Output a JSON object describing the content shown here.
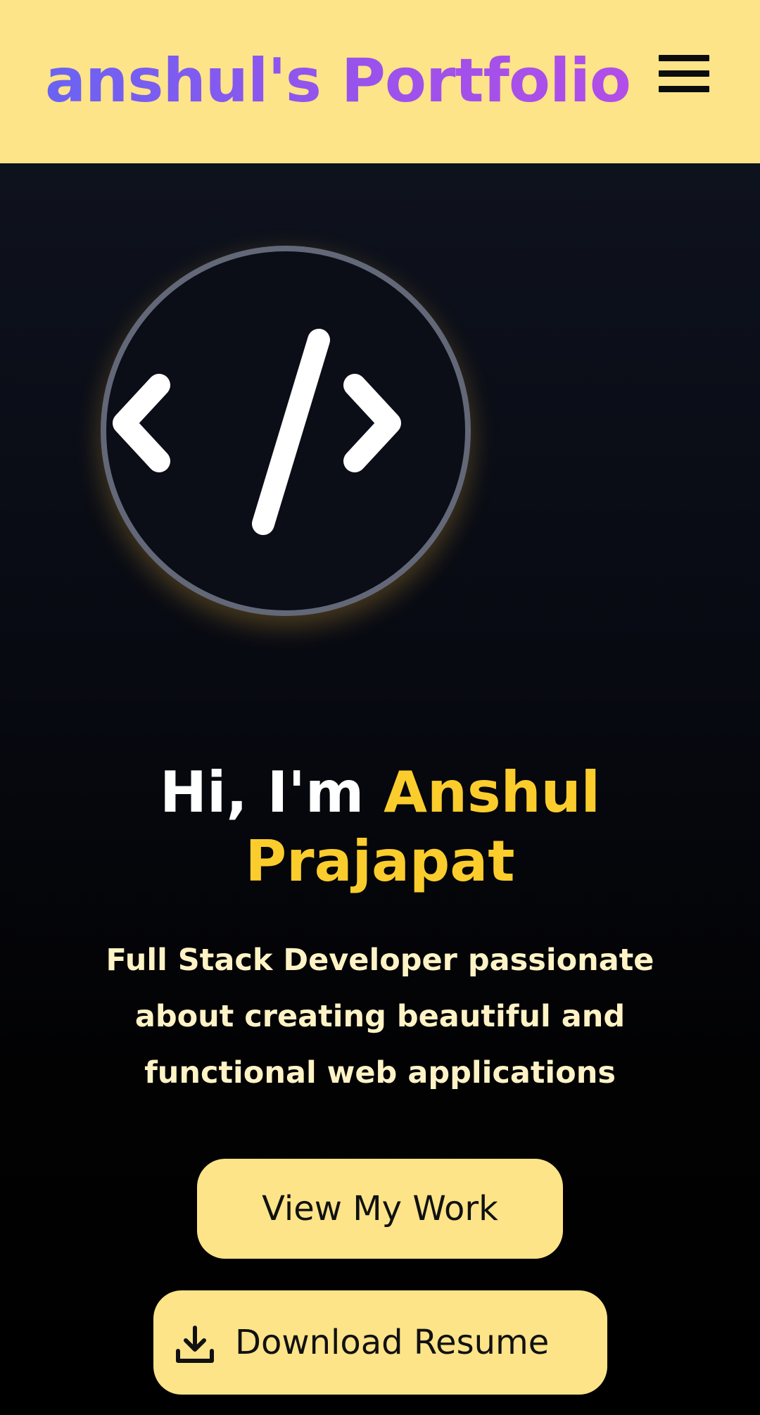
{
  "header": {
    "brand": "anshul's Portfolio",
    "menu_icon": "hamburger-menu-icon"
  },
  "hero": {
    "logo_icon": "code-brackets-icon",
    "greeting": "Hi, I'm ",
    "name": "Anshul Prajapat",
    "tagline": "Full Stack Developer passionate about creating beautiful and functional web applications",
    "primary_button": "View My Work",
    "secondary_button": "Download Resume",
    "secondary_button_icon": "download-icon"
  },
  "colors": {
    "header_bg": "#fde488",
    "accent_yellow": "#fbcd2c",
    "brand_gradient_start": "#6a63f2",
    "brand_gradient_end": "#b24ee8",
    "button_bg": "#fde488",
    "page_bg": "#000000"
  }
}
